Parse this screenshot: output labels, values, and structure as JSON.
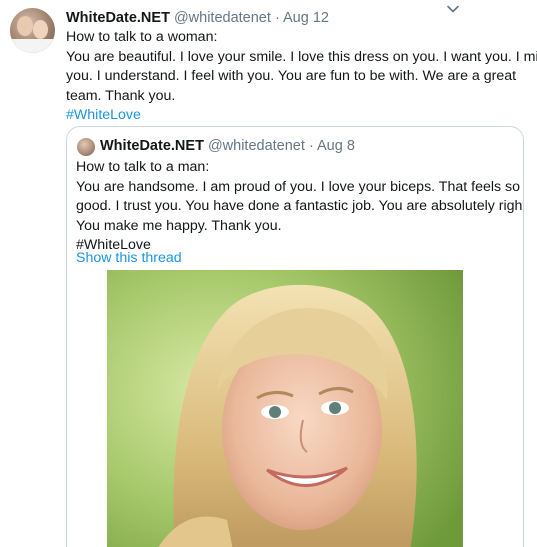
{
  "tweet": {
    "name": "WhiteDate.NET",
    "handle": "@whitedatenet",
    "separator": "·",
    "date": "Aug 12",
    "text_lines": [
      "How to talk to a woman:",
      "You are beautiful. I love your smile. I love this dress on you. I want you. I miss",
      "you. I understand. I feel with you. You are fun to be with. We are a great",
      "team. Thank you."
    ],
    "hashtag": "#WhiteLove"
  },
  "quoted": {
    "name": "WhiteDate.NET",
    "handle": "@whitedatenet",
    "separator": "·",
    "date": "Aug 8",
    "text_lines": [
      "How to talk to a man:",
      "You are handsome. I am proud of you. I love your biceps. That feels so",
      "good. I trust you. You have done a fantastic job. You are absolutely right.",
      "You make me happy. Thank you.",
      "#WhiteLove"
    ],
    "thread_link": "Show this thread"
  },
  "colors": {
    "text": "#14171a",
    "secondary": "#657786",
    "link": "#1b95e0",
    "border": "#ccd6dd"
  },
  "icons": {
    "menu": "chevron-down-icon"
  }
}
